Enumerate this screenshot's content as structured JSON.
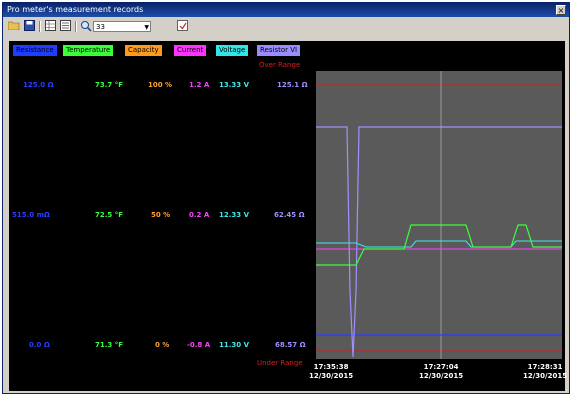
{
  "window": {
    "title": "Pro meter's measurement records",
    "close_glyph": "×"
  },
  "toolbar": {
    "zoom_value": "33",
    "icons": [
      "open-icon",
      "save-icon",
      "grid-icon",
      "list-icon",
      "zoom-icon",
      "export-icon"
    ]
  },
  "legend": [
    {
      "label": "Resistance",
      "bg": "#1f3cff",
      "fg": "#000000"
    },
    {
      "label": "Temperature",
      "bg": "#39ff39",
      "fg": "#000000"
    },
    {
      "label": "Capacity",
      "bg": "#ff9a1a",
      "fg": "#000000"
    },
    {
      "label": "Current",
      "bg": "#ff33ff",
      "fg": "#000000"
    },
    {
      "label": "Voltage",
      "bg": "#33e5e5",
      "fg": "#000000"
    },
    {
      "label": "Resistor VI",
      "bg": "#9a8cff",
      "fg": "#000000"
    }
  ],
  "ranges": {
    "over": "Over Range",
    "under": "Under Range"
  },
  "scale_rows": [
    {
      "resistance": "125.0 Ω",
      "temperature": "73.7 °F",
      "capacity": "100 %",
      "current": "1.2 A",
      "voltage": "13.33 V",
      "resistor_vi": "125.1 Ω"
    },
    {
      "resistance": "515.0 mΩ",
      "temperature": "72.5 °F",
      "capacity": "50 %",
      "current": "0.2 A",
      "voltage": "12.33 V",
      "resistor_vi": "62.45 Ω"
    },
    {
      "resistance": "0.0 Ω",
      "temperature": "71.3 °F",
      "capacity": "0 %",
      "current": "-0.8 A",
      "voltage": "11.30 V",
      "resistor_vi": "68.57 Ω"
    }
  ],
  "timestamps": [
    {
      "time": "17:35:38",
      "date": "12/30/2015"
    },
    {
      "time": "17:27:04",
      "date": "12/30/2015"
    },
    {
      "time": "17:28:31",
      "date": "12/30/2015"
    }
  ],
  "colors": {
    "resistance": "#2a3cff",
    "temperature": "#3cff3c",
    "capacity": "#ffa030",
    "current": "#ff40ff",
    "voltage": "#40e8e8",
    "resistor_vi": "#a090ff",
    "over_range": "#d02020"
  }
}
